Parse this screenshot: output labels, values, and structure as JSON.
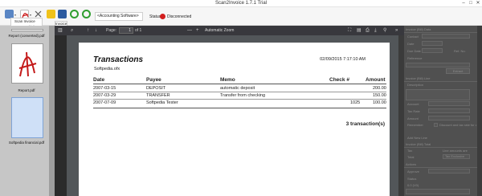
{
  "window": {
    "title": "Scan2Invoice 1.7.1 Trial",
    "minimize": "–",
    "maximize": "□",
    "close": "✕"
  },
  "toolbar": {
    "account_select": "<Accounting Software>",
    "status_label": "Status:",
    "status_text": "Disconnected",
    "status_color": "#d21f1f",
    "icons": [
      "scan-icon",
      "pdf-icon",
      "scissors-icon",
      "lock-icon",
      "refresh-icon",
      "sync-icon",
      "panel-icon"
    ]
  },
  "menu": {
    "items": [
      "Scan Invoice",
      "Scan Multiple"
    ]
  },
  "invoice_tab": "Invoice",
  "thumbnails": [
    {
      "label": "Report (converted).pdf"
    },
    {
      "label": "Report.pdf"
    },
    {
      "label": "Softpedia financial.pdf"
    }
  ],
  "viewer": {
    "page_label": "Page:",
    "page_value": "1",
    "page_of": "of 1",
    "zoom_minus": "—",
    "zoom_plus": "+",
    "zoom": "Automatic Zoom"
  },
  "document": {
    "title": "Transactions",
    "date": "02/09/2015 7:17:10 AM",
    "file": "Softpedia.ofx",
    "headers": {
      "date": "Date",
      "payee": "Payee",
      "memo": "Memo",
      "check": "Check #",
      "amount": "Amount"
    },
    "rows": [
      {
        "date": "2007-03-15",
        "payee": "DEPOSIT",
        "memo": "automatic deposit",
        "check": "",
        "amount": "200.00"
      },
      {
        "date": "2007-03-29",
        "payee": "TRANSFER",
        "memo": "Transfer from checking",
        "check": "",
        "amount": "150.00"
      },
      {
        "date": "2007-07-09",
        "payee": "Softpedia Tester",
        "memo": "",
        "check": "1025",
        "amount": "100.00"
      }
    ],
    "count": "3 transaction(s)"
  },
  "right_panel": {
    "invoice_bill_data": "Invoice (Bill) Data",
    "contact": "Contact",
    "date": "Date",
    "due_date": "Due Date",
    "ref_no": "Ref. No.",
    "reference": "Reference",
    "extract": "Extract",
    "invoice_bill_line": "Invoice (Bill) Line",
    "description": "Description",
    "account": "Account",
    "tax_rate": "Tax Rate",
    "amount": "Amount",
    "remember": "Remember",
    "discount_label": "Discount and tax rate for cont",
    "add_new_line": "Add New Line",
    "invoice_bill_total": "Invoice (Bill) Total",
    "tax": "Tax",
    "line_amounts": "Line amounts are",
    "total": "Total",
    "tax_exclusive": "Tax Exclusive",
    "actions": "Actions",
    "approve": "Approve",
    "status": "Status",
    "status_value": "0.0 (V0)"
  }
}
